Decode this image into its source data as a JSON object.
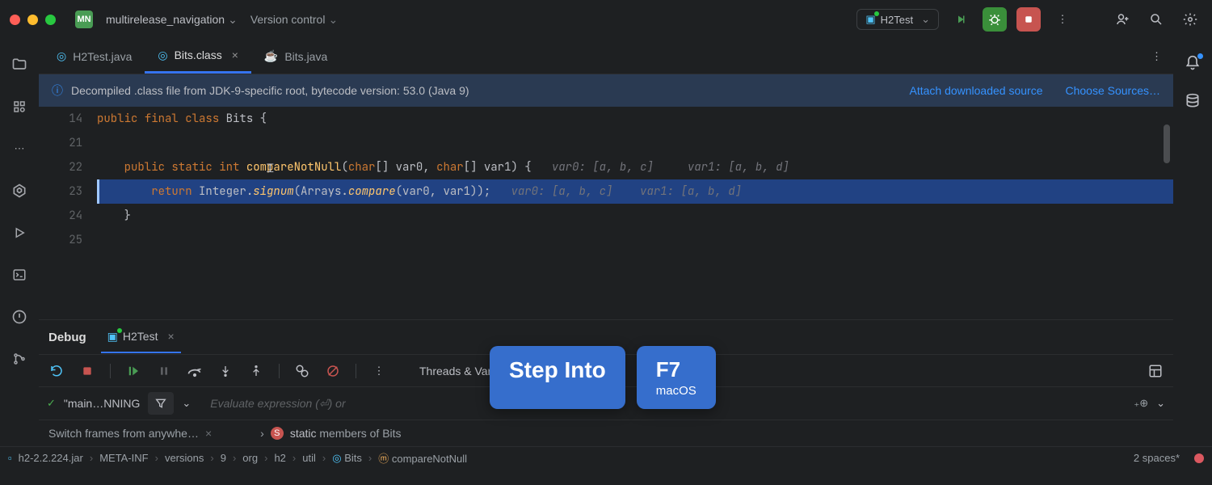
{
  "titlebar": {
    "project_badge": "MN",
    "project_name": "multirelease_navigation",
    "vcs_label": "Version control",
    "run_config": "H2Test"
  },
  "tabs": [
    {
      "label": "H2Test.java"
    },
    {
      "label": "Bits.class"
    },
    {
      "label": "Bits.java"
    }
  ],
  "banner": {
    "message": "Decompiled .class file from JDK-9-specific root, bytecode version: 53.0 (Java 9)",
    "link_attach": "Attach downloaded source",
    "link_choose": "Choose Sources…"
  },
  "code": {
    "gutter": [
      "14",
      "21",
      "22",
      "23",
      "24",
      "25"
    ],
    "L14": {
      "k1": "public ",
      "k2": "final ",
      "k3": "class ",
      "cls": "Bits ",
      "b": "{"
    },
    "L22": {
      "k1": "    public ",
      "k2": "static ",
      "k3": "int ",
      "fn": "compareNotNull",
      "args": "(",
      "t1": "char",
      "a1": "[] var0, ",
      "t2": "char",
      "a2": "[] var1) {   ",
      "dim": "var0: [a, b, c]     var1: [a, b, d]"
    },
    "L23": {
      "pad": "        ",
      "k1": "return ",
      "cls": "Integer.",
      "fn": "signum",
      "args": "(Arrays.",
      "fn2": "compare",
      "args2": "(var0, var1));   ",
      "dim": "var0: [a, b, c]    var1: [a, b, d]"
    },
    "L24": "    }"
  },
  "debug": {
    "tab_label": "Debug",
    "sub_label": "H2Test",
    "threads_label": "Threads & Vari",
    "main_thread": "\"main…NNING",
    "eval_placeholder": "Evaluate expression (⏎) or",
    "switch_frames": "Switch frames from anywhe…",
    "static_label_prefix": "static ",
    "static_label_rest": "members of Bits"
  },
  "tooltip": {
    "label": "Step Into",
    "key": "F7",
    "os": "macOS"
  },
  "statusbar": {
    "crumbs": [
      "h2-2.2.224.jar",
      "META-INF",
      "versions",
      "9",
      "org",
      "h2",
      "util",
      "Bits",
      "compareNotNull"
    ],
    "spaces": "2 spaces*"
  }
}
